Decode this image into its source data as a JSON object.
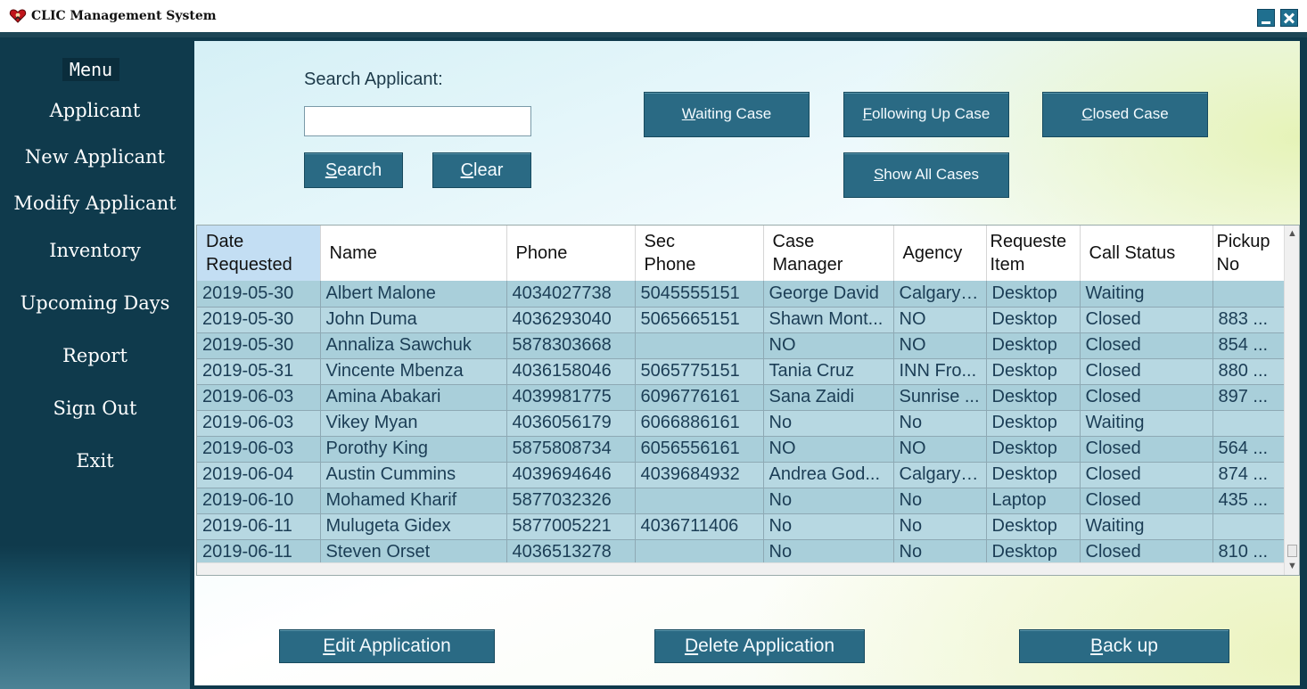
{
  "window": {
    "title": "CLIC Management System"
  },
  "sidebar": {
    "menu_label": "Menu",
    "items": [
      {
        "label": "Applicant"
      },
      {
        "label": "New Applicant"
      },
      {
        "label": "Modify Applicant"
      },
      {
        "label": "Inventory"
      },
      {
        "label": "Upcoming Days"
      },
      {
        "label": "Report"
      },
      {
        "label": "Sign Out"
      },
      {
        "label": "Exit"
      }
    ]
  },
  "search": {
    "label": "Search Applicant:",
    "value": "",
    "search_button": {
      "first": "S",
      "rest": "earch"
    },
    "clear_button": {
      "first": "C",
      "rest": "lear"
    }
  },
  "filters": {
    "waiting": {
      "first": "W",
      "rest": "aiting Case"
    },
    "following": {
      "first": "F",
      "rest": "ollowing Up Case"
    },
    "closed": {
      "first": "C",
      "rest": "losed Case"
    },
    "show_all": {
      "first": "S",
      "rest": "how All Cases"
    }
  },
  "table": {
    "columns": [
      {
        "l1": "Date",
        "l2": "Requested"
      },
      {
        "l1": "Name",
        "l2": ""
      },
      {
        "l1": "Phone",
        "l2": ""
      },
      {
        "l1": "Sec",
        "l2": "Phone"
      },
      {
        "l1": "Case",
        "l2": "Manager"
      },
      {
        "l1": "Agency",
        "l2": ""
      },
      {
        "l1": "Requeste",
        "l2": "Item"
      },
      {
        "l1": "Call Status",
        "l2": ""
      },
      {
        "l1": "Pickup",
        "l2": "No"
      }
    ],
    "rows": [
      [
        "2019-05-30",
        "Albert Malone",
        "4034027738",
        "5045555151",
        "George David",
        "Calgary ...",
        "Desktop",
        "Waiting",
        ""
      ],
      [
        "2019-05-30",
        "John Duma",
        "4036293040",
        "5065665151",
        "Shawn Mont...",
        "NO",
        "Desktop",
        "Closed",
        "883 ..."
      ],
      [
        "2019-05-30",
        "Annaliza Sawchuk",
        "5878303668",
        "",
        "NO",
        "NO",
        "Desktop",
        "Closed",
        "854 ..."
      ],
      [
        "2019-05-31",
        "Vincente Mbenza",
        "4036158046",
        "5065775151",
        "Tania Cruz",
        "INN Fro...",
        "Desktop",
        "Closed",
        "880 ..."
      ],
      [
        "2019-06-03",
        "Amina Abakari",
        "4039981775",
        "6096776161",
        "Sana Zaidi",
        "Sunrise ...",
        "Desktop",
        "Closed",
        "897 ..."
      ],
      [
        "2019-06-03",
        "Vikey Myan",
        "4036056179",
        "6066886161",
        "No",
        "No",
        "Desktop",
        "Waiting",
        ""
      ],
      [
        "2019-06-03",
        "Porothy King",
        "5875808734",
        "6056556161",
        "NO",
        "NO",
        "Desktop",
        "Closed",
        "564 ..."
      ],
      [
        "2019-06-04",
        "Austin Cummins",
        "4039694646",
        "4039684932",
        "Andrea God...",
        "Calgary ...",
        "Desktop",
        "Closed",
        "874 ..."
      ],
      [
        "2019-06-10",
        "Mohamed Kharif",
        "5877032326",
        "",
        "No",
        "No",
        "Laptop",
        "Closed",
        "435 ..."
      ],
      [
        "2019-06-11",
        "Mulugeta Gidex",
        "5877005221",
        "4036711406",
        "No",
        "No",
        "Desktop",
        "Waiting",
        ""
      ],
      [
        "2019-06-11",
        "Steven Orset",
        "4036513278",
        "",
        "No",
        "No",
        "Desktop",
        "Closed",
        "810 ..."
      ]
    ]
  },
  "actions": {
    "edit": {
      "first": "E",
      "rest": "dit Application"
    },
    "delete": {
      "first": "D",
      "rest": "elete Application"
    },
    "backup": {
      "first": "B",
      "rest": "ack up"
    }
  },
  "colors": {
    "sidebar": "#0f3a4c",
    "button": "#2a6a84",
    "row_odd": "#a9cfda",
    "row_even": "#b7d8e2",
    "header_selected": "#c3def3"
  },
  "icons": {
    "app": "heart-icon"
  }
}
